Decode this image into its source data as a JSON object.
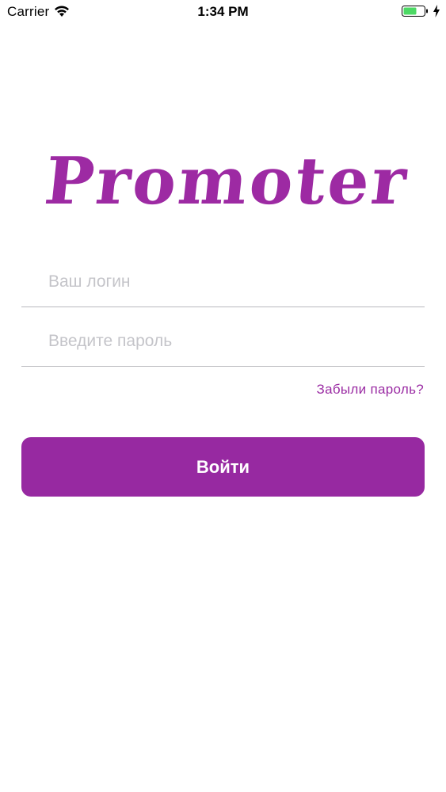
{
  "status_bar": {
    "carrier": "Carrier",
    "time": "1:34 PM",
    "battery_color": "#4cd964"
  },
  "logo": {
    "text": "Promoter",
    "color": "#9d2aa3"
  },
  "login_form": {
    "login_placeholder": "Ваш логин",
    "login_value": "",
    "password_placeholder": "Введите пароль",
    "password_value": "",
    "forgot_label": "Забыли пароль?",
    "submit_label": "Войти",
    "accent_color": "#9729a1"
  }
}
